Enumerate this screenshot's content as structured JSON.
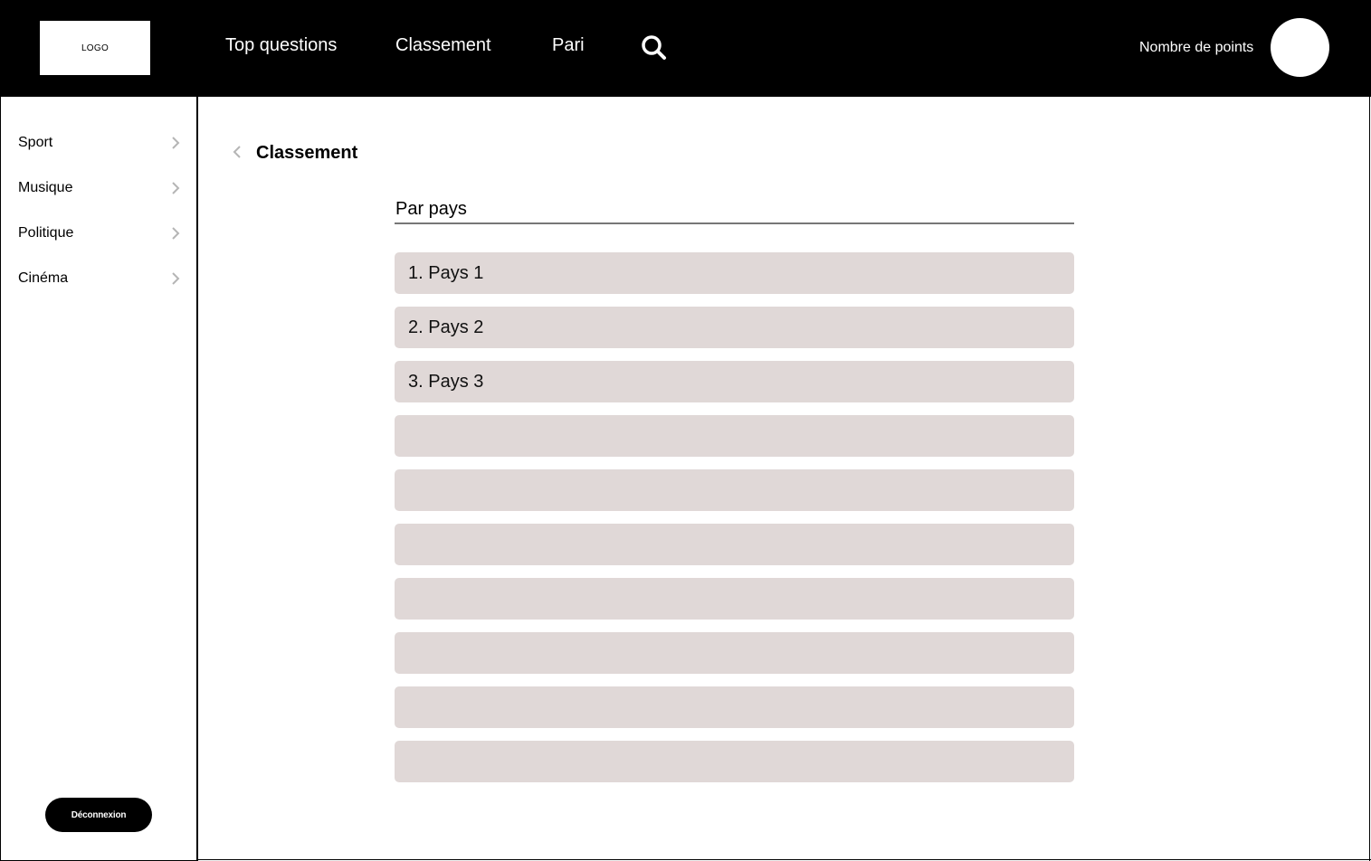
{
  "header": {
    "logo_text": "LOGO",
    "nav": {
      "top_questions": "Top questions",
      "classement": "Classement",
      "pari": "Pari"
    },
    "search_icon": "search-icon",
    "points_label": "Nombre de points"
  },
  "sidebar": {
    "items": [
      {
        "label": "Sport"
      },
      {
        "label": "Musique"
      },
      {
        "label": "Politique"
      },
      {
        "label": "Cinéma"
      }
    ],
    "logout_label": "Déconnexion"
  },
  "main": {
    "title": "Classement",
    "section_title": "Par pays",
    "rankings": [
      "1. Pays 1",
      "2. Pays 2",
      "3. Pays 3",
      "",
      "",
      "",
      "",
      "",
      "",
      ""
    ]
  },
  "colors": {
    "header_bg": "#000000",
    "row_bg": "#e0d8d7",
    "chevron": "#b5b5b5"
  }
}
